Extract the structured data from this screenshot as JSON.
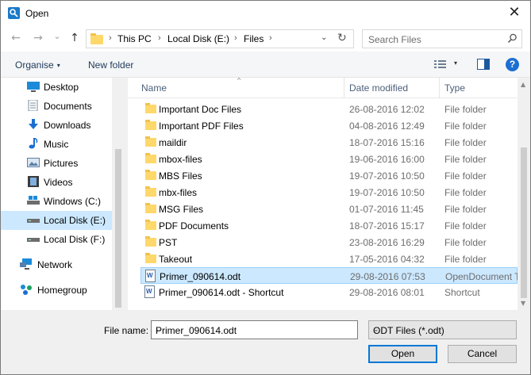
{
  "window": {
    "title": "Open",
    "close_glyph": "✕"
  },
  "nav": {
    "back": "←",
    "forward": "→",
    "recent": "⌄",
    "up": "↑",
    "breadcrumb": [
      "This PC",
      "Local Disk (E:)",
      "Files"
    ],
    "separator": "›",
    "dropdown_glyph": "⌄",
    "refresh_glyph": "↻",
    "search_placeholder": "Search Files"
  },
  "toolbar": {
    "organise": "Organise",
    "new_folder": "New folder",
    "caret": "▾",
    "help": "?"
  },
  "sidebar": {
    "items": [
      {
        "label": "Desktop",
        "icon": "desktop-icon",
        "color": "#1c8ad9"
      },
      {
        "label": "Documents",
        "icon": "documents-icon",
        "color": "#7a8ca0"
      },
      {
        "label": "Downloads",
        "icon": "downloads-icon",
        "color": "#1c6fd2"
      },
      {
        "label": "Music",
        "icon": "music-icon",
        "color": "#1c6fd2"
      },
      {
        "label": "Pictures",
        "icon": "pictures-icon",
        "color": "#5b7fa6"
      },
      {
        "label": "Videos",
        "icon": "videos-icon",
        "color": "#3b3b3b"
      },
      {
        "label": "Windows (C:)",
        "icon": "windows-drive-icon",
        "color": "#555"
      },
      {
        "label": "Local Disk (E:)",
        "icon": "drive-icon",
        "color": "#555",
        "selected": true
      },
      {
        "label": "Local Disk (F:)",
        "icon": "drive-icon",
        "color": "#555"
      },
      {
        "label": "Network",
        "icon": "network-icon",
        "color": "#1c8ad9"
      },
      {
        "label": "Homegroup",
        "icon": "homegroup-icon",
        "color": "#1aa260"
      }
    ]
  },
  "columns": {
    "name": "Name",
    "date": "Date modified",
    "type": "Type",
    "sort_glyph": "^"
  },
  "files": [
    {
      "name": "Important Doc Files",
      "date": "26-08-2016 12:02",
      "type": "File folder",
      "kind": "folder"
    },
    {
      "name": "Important PDF Files",
      "date": "04-08-2016 12:49",
      "type": "File folder",
      "kind": "folder"
    },
    {
      "name": "maildir",
      "date": "18-07-2016 15:16",
      "type": "File folder",
      "kind": "folder"
    },
    {
      "name": "mbox-files",
      "date": "19-06-2016 16:00",
      "type": "File folder",
      "kind": "folder"
    },
    {
      "name": "MBS Files",
      "date": "19-07-2016 10:50",
      "type": "File folder",
      "kind": "folder"
    },
    {
      "name": "mbx-files",
      "date": "19-07-2016 10:50",
      "type": "File folder",
      "kind": "folder"
    },
    {
      "name": "MSG Files",
      "date": "01-07-2016 11:45",
      "type": "File folder",
      "kind": "folder"
    },
    {
      "name": "PDF Documents",
      "date": "18-07-2016 15:17",
      "type": "File folder",
      "kind": "folder"
    },
    {
      "name": "PST",
      "date": "23-08-2016 16:29",
      "type": "File folder",
      "kind": "folder"
    },
    {
      "name": "Takeout",
      "date": "17-05-2016 04:32",
      "type": "File folder",
      "kind": "folder"
    },
    {
      "name": "Primer_090614.odt",
      "date": "29-08-2016 07:53",
      "type": "OpenDocument T",
      "kind": "doc",
      "selected": true
    },
    {
      "name": "Primer_090614.odt - Shortcut",
      "date": "29-08-2016 08:01",
      "type": "Shortcut",
      "kind": "doc"
    }
  ],
  "bottom": {
    "file_name_label": "File name:",
    "file_name_value": "Primer_090614.odt",
    "file_type_value": "ODT Files (*.odt)",
    "open": "Open",
    "cancel": "Cancel",
    "caret": "⌄"
  },
  "colors": {
    "accent": "#0078d7",
    "selection": "#cce8ff",
    "link": "#1e395b"
  }
}
